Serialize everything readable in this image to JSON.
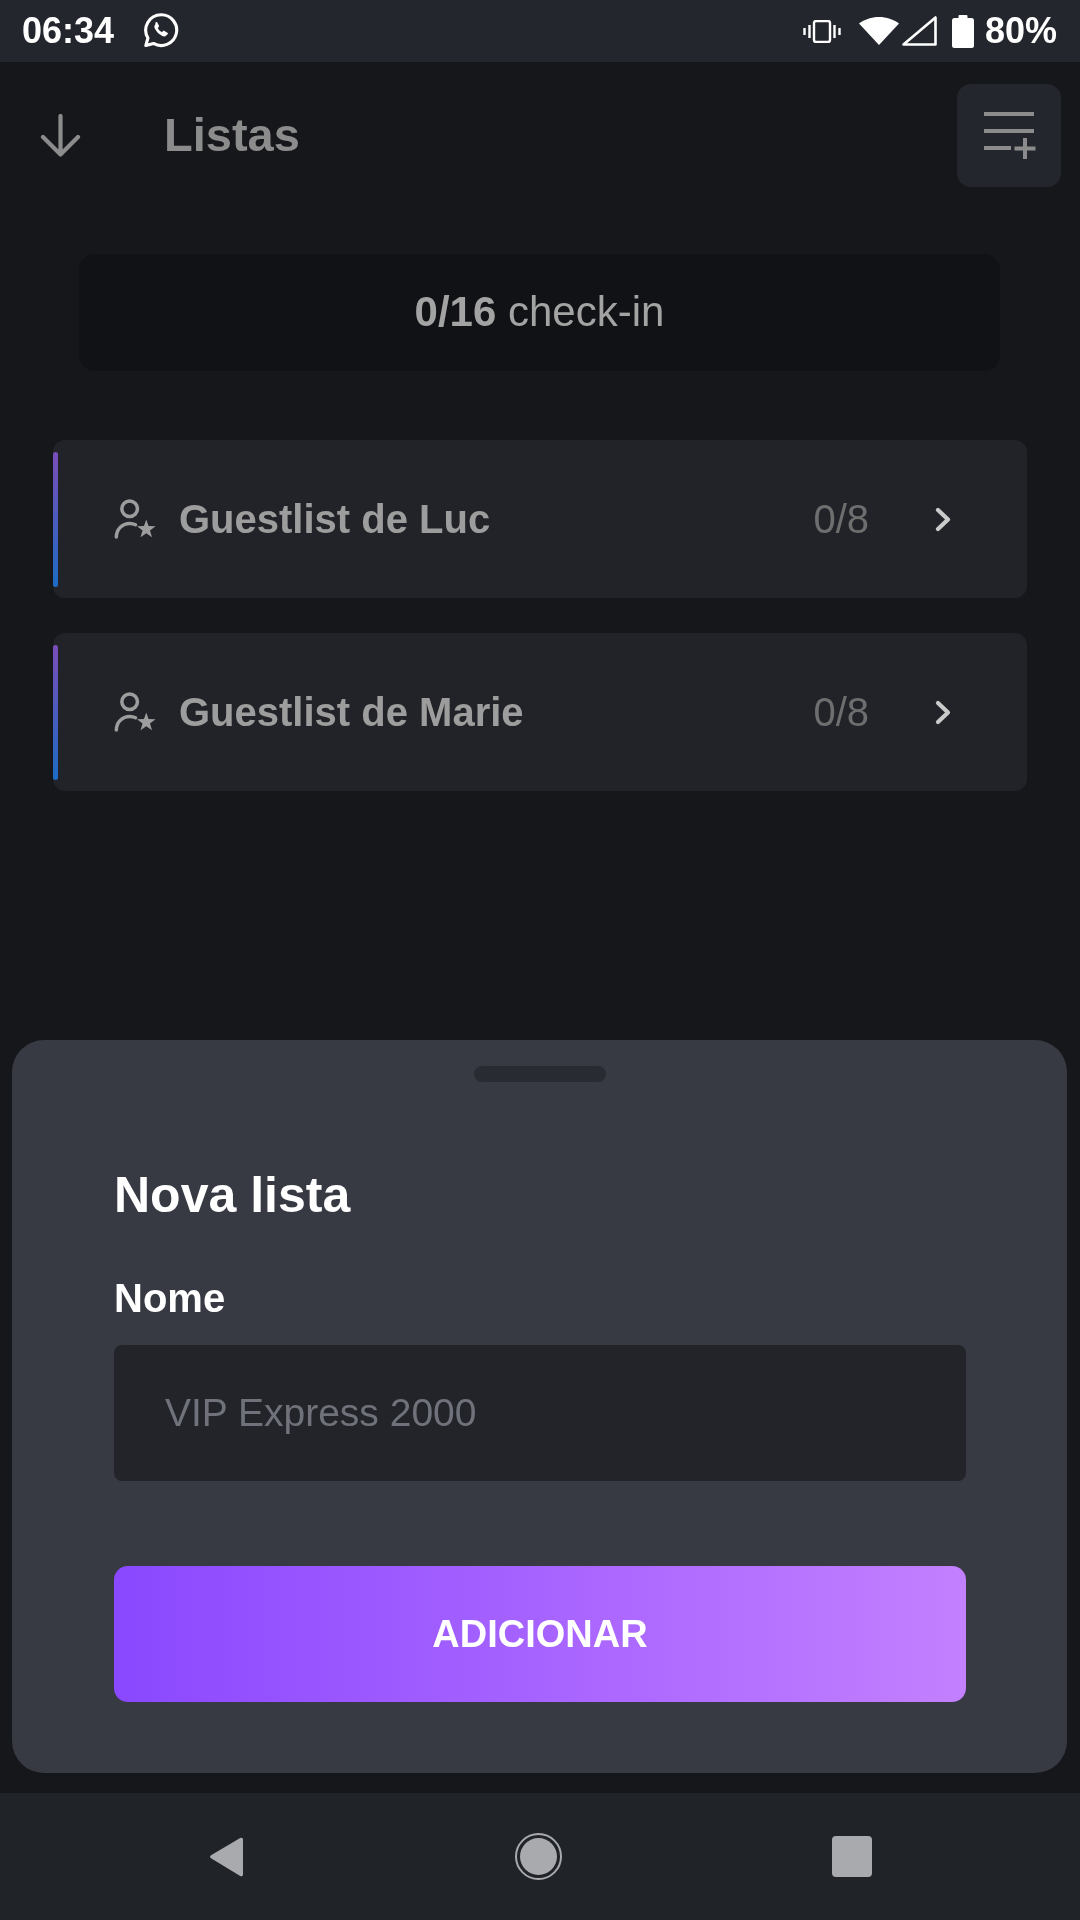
{
  "status_bar": {
    "time": "06:34",
    "battery": "80%"
  },
  "header": {
    "title": "Listas"
  },
  "summary": {
    "text": "**0/16** check-in"
  },
  "lists": [
    {
      "name": "Guestlist de Luc",
      "count": "0/8"
    },
    {
      "name": "Guestlist de Marie",
      "count": "0/8"
    }
  ],
  "sheet": {
    "title": "Nova lista",
    "field": {
      "label": "Nome",
      "placeholder": "VIP Express 2000"
    },
    "button": "ADICIONAR"
  }
}
